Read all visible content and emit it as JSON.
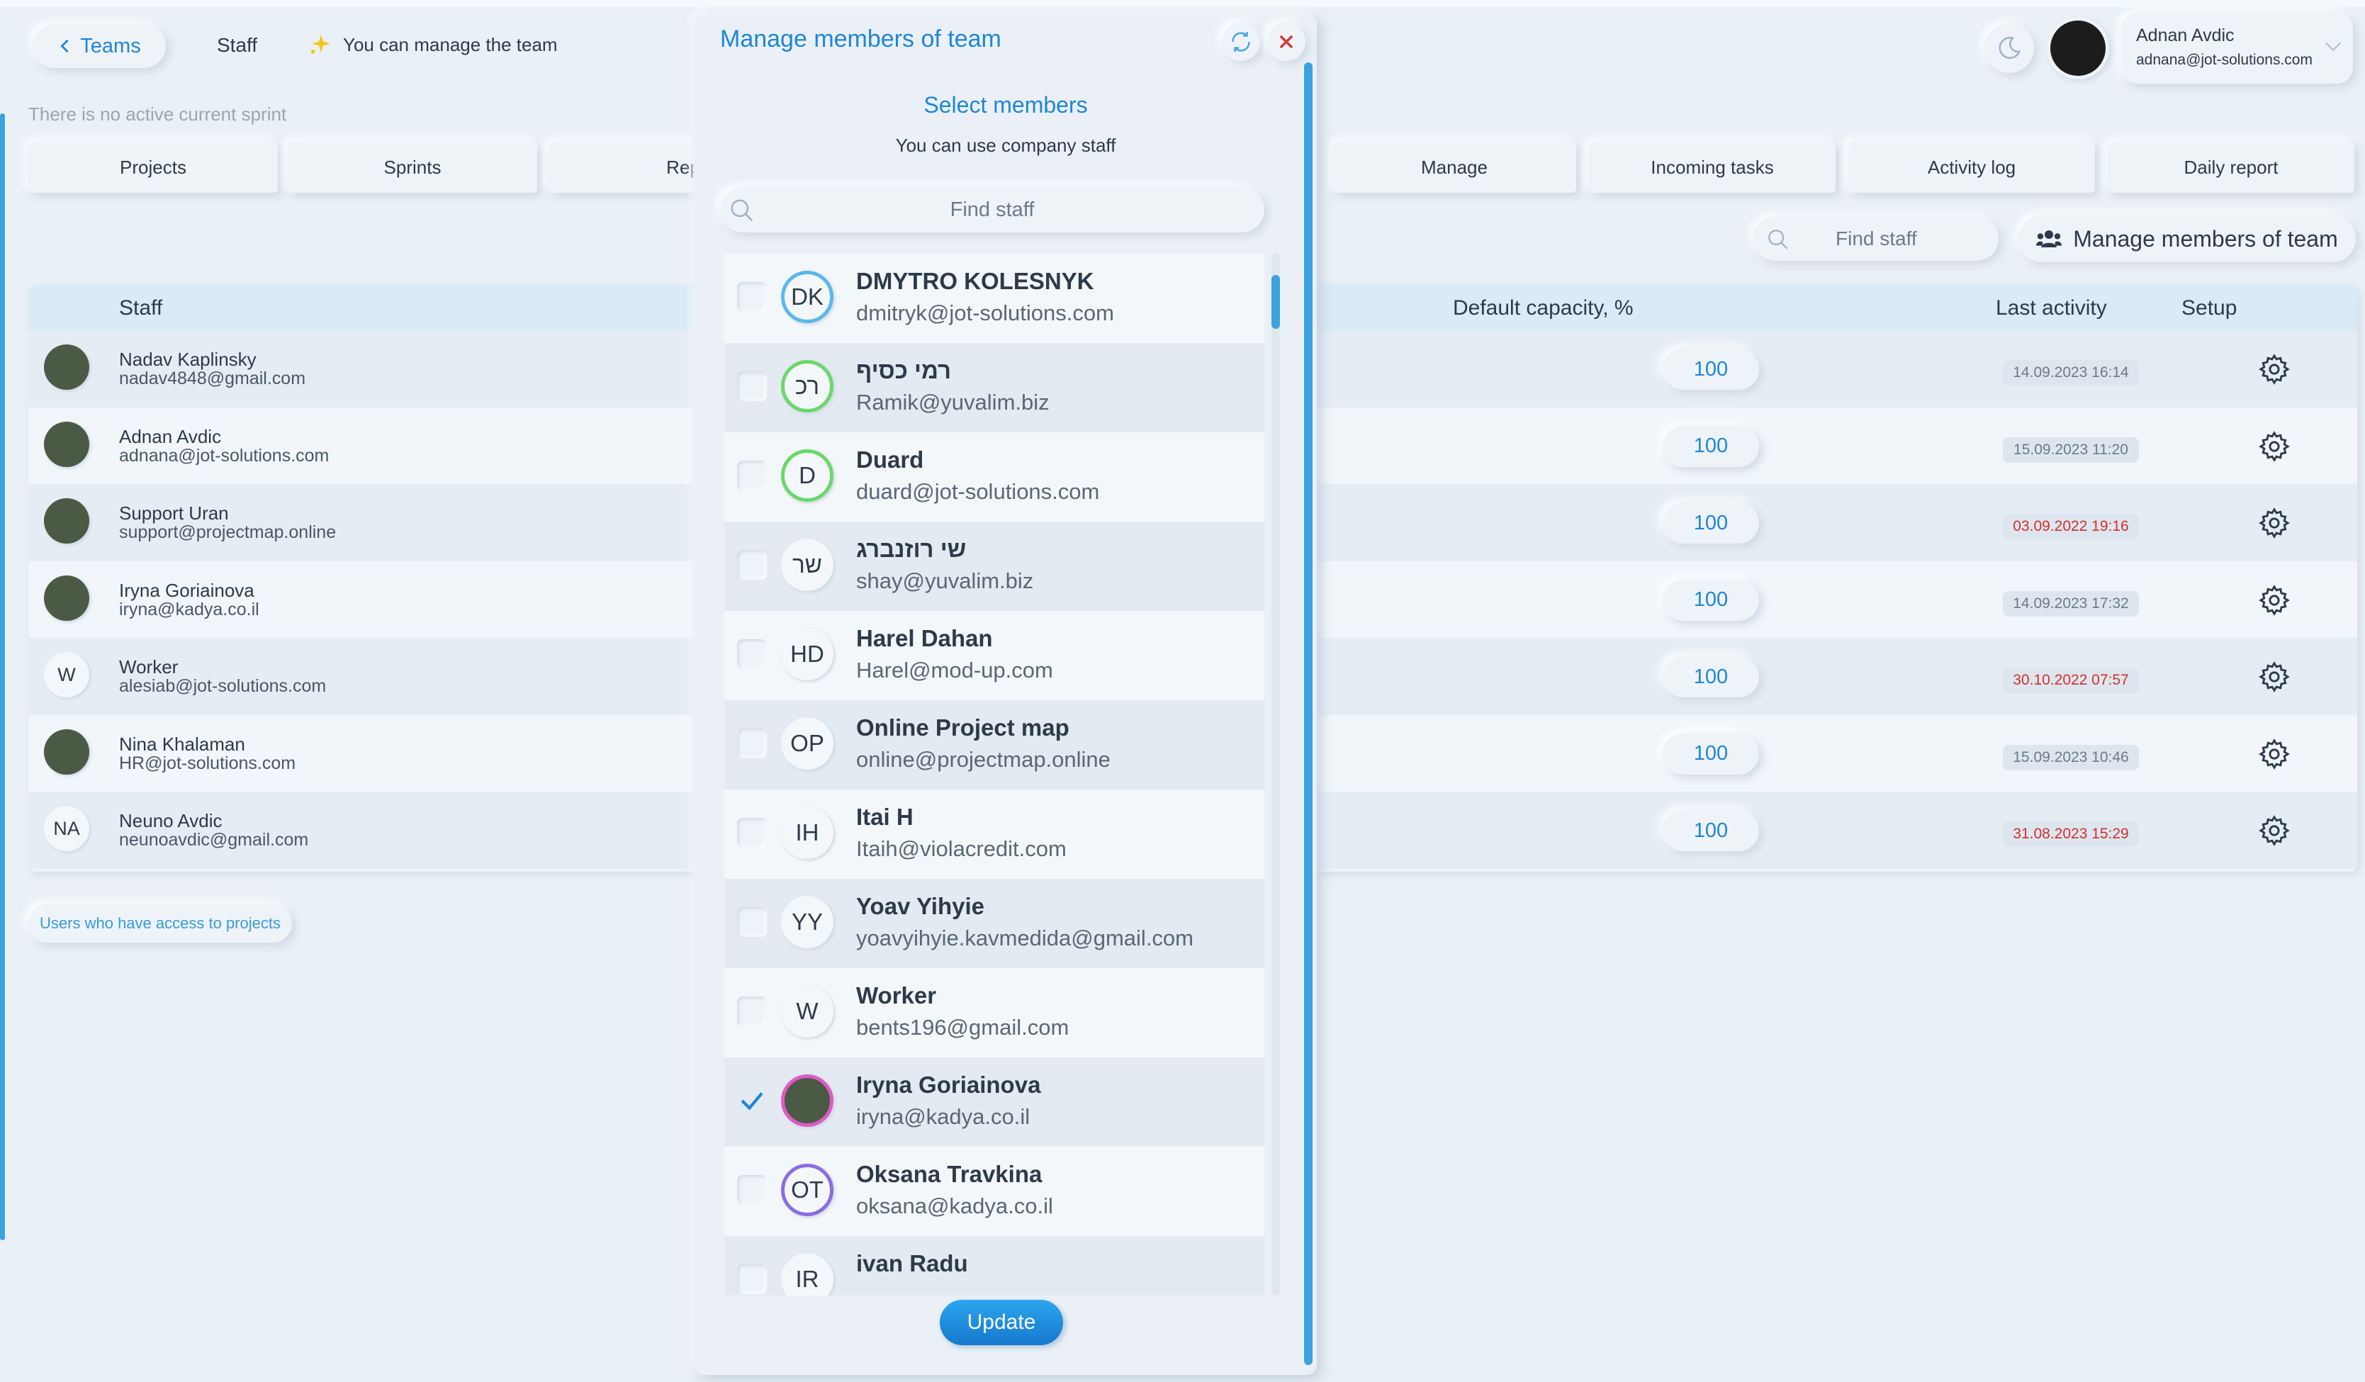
{
  "header": {
    "back_label": "Teams",
    "section": "Staff",
    "permission_note": "You can manage the team",
    "sprint_status": "There is no active current sprint"
  },
  "user": {
    "name": "Adnan Avdic",
    "email": "adnana@jot-solutions.com"
  },
  "tabs": [
    {
      "label": "Projects"
    },
    {
      "label": "Sprints"
    },
    {
      "label": "Reporti"
    },
    {
      "label": "Manage"
    },
    {
      "label": "Incoming tasks"
    },
    {
      "label": "Activity log"
    },
    {
      "label": "Daily report"
    }
  ],
  "toolbar": {
    "find_placeholder": "Find staff",
    "manage_label": "Manage members of team"
  },
  "table": {
    "headers": {
      "staff": "Staff",
      "capacity": "Default capacity, %",
      "last_activity": "Last activity",
      "setup": "Setup"
    },
    "rows": [
      {
        "initials": "",
        "photo": true,
        "name": "Nadav Kaplinsky",
        "email": "nadav4848@gmail.com",
        "capacity": "100",
        "last": "14.09.2023 16:14",
        "stale": false
      },
      {
        "initials": "",
        "photo": true,
        "name": "Adnan Avdic",
        "email": "adnana@jot-solutions.com",
        "capacity": "100",
        "last": "15.09.2023 11:20",
        "stale": false
      },
      {
        "initials": "",
        "photo": true,
        "name": "Support Uran",
        "email": "support@projectmap.online",
        "capacity": "100",
        "last": "03.09.2022 19:16",
        "stale": true
      },
      {
        "initials": "",
        "photo": true,
        "name": "Iryna Goriainova",
        "email": "iryna@kadya.co.il",
        "capacity": "100",
        "last": "14.09.2023 17:32",
        "stale": false
      },
      {
        "initials": "W",
        "photo": false,
        "name": "Worker",
        "email": "alesiab@jot-solutions.com",
        "capacity": "100",
        "last": "30.10.2022 07:57",
        "stale": true
      },
      {
        "initials": "",
        "photo": true,
        "name": "Nina Khalaman",
        "email": "HR@jot-solutions.com",
        "capacity": "100",
        "last": "15.09.2023 10:46",
        "stale": false
      },
      {
        "initials": "NA",
        "photo": false,
        "name": "Neuno Avdic",
        "email": "neunoavdic@gmail.com",
        "capacity": "100",
        "last": "31.08.2023 15:29",
        "stale": true
      }
    ]
  },
  "access_link": "Users who have access to projects",
  "modal": {
    "title": "Manage members of team",
    "subtitle": "Select members",
    "hint": "You can use company staff",
    "search_placeholder": "Find staff",
    "update_label": "Update",
    "members": [
      {
        "initials": "DK",
        "name": "DMYTRO KOLESNYK",
        "email": "dmitryk@jot-solutions.com",
        "checked": false,
        "ring": "#5db7ea"
      },
      {
        "initials": "רכ",
        "name": "רמי כסיף",
        "email": "Ramik@yuvalim.biz",
        "checked": false,
        "ring": "#6ad86a"
      },
      {
        "initials": "D",
        "name": "Duard",
        "email": "duard@jot-solutions.com",
        "checked": false,
        "ring": "#6ad86a"
      },
      {
        "initials": "שר",
        "name": "שי רוזנברג",
        "email": "shay@yuvalim.biz",
        "checked": false,
        "ring": ""
      },
      {
        "initials": "HD",
        "name": "Harel Dahan",
        "email": "Harel@mod-up.com",
        "checked": false,
        "ring": ""
      },
      {
        "initials": "OP",
        "name": "Online Project map",
        "email": "online@projectmap.online",
        "checked": false,
        "ring": ""
      },
      {
        "initials": "IH",
        "name": "Itai H",
        "email": "Itaih@violacredit.com",
        "checked": false,
        "ring": ""
      },
      {
        "initials": "YY",
        "name": "Yoav Yihyie",
        "email": "yoavyihyie.kavmedida@gmail.com",
        "checked": false,
        "ring": ""
      },
      {
        "initials": "W",
        "name": "Worker",
        "email": "bents196@gmail.com",
        "checked": false,
        "ring": ""
      },
      {
        "initials": "",
        "name": "Iryna Goriainova",
        "email": "iryna@kadya.co.il",
        "checked": true,
        "ring": "#e05ac8"
      },
      {
        "initials": "OT",
        "name": "Oksana Travkina",
        "email": "oksana@kadya.co.il",
        "checked": false,
        "ring": "#8a6ee0"
      },
      {
        "initials": "IR",
        "name": "ivan Radu",
        "email": "",
        "checked": false,
        "ring": ""
      }
    ]
  }
}
